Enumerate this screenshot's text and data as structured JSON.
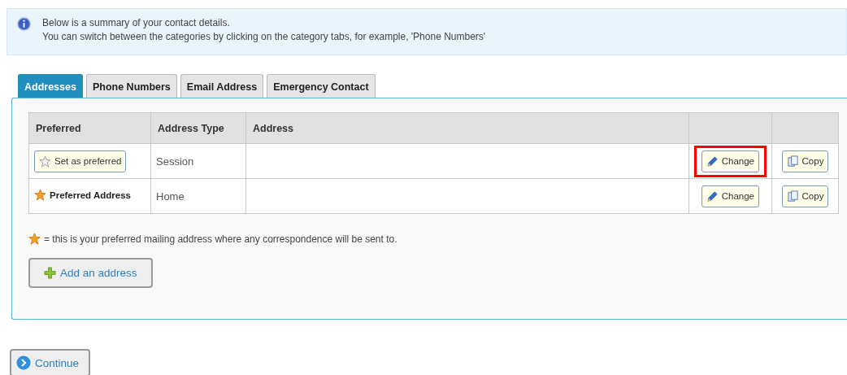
{
  "info": {
    "lines": [
      "Below is a summary of your contact details.",
      "You can switch between the categories by clicking on the category tabs, for example, 'Phone Numbers'"
    ]
  },
  "tabs": [
    {
      "label": "Addresses",
      "selected": true
    },
    {
      "label": "Phone Numbers",
      "selected": false
    },
    {
      "label": "Email Address",
      "selected": false
    },
    {
      "label": "Emergency Contact",
      "selected": false
    }
  ],
  "table": {
    "columns": [
      "Preferred",
      "Address Type",
      "Address"
    ],
    "rows": [
      {
        "preferred": false,
        "preferred_label": "Set as preferred",
        "address_type": "Session",
        "change": "Change",
        "copy": "Copy",
        "highlighted": true
      },
      {
        "preferred": true,
        "preferred_label": "Preferred Address",
        "address_type": "Home",
        "change": "Change",
        "copy": "Copy",
        "highlighted": false
      }
    ]
  },
  "legend": "= this is your preferred mailing address where any correspondence will be sent to.",
  "add_button": "Add an address",
  "continue_button": "Continue"
}
